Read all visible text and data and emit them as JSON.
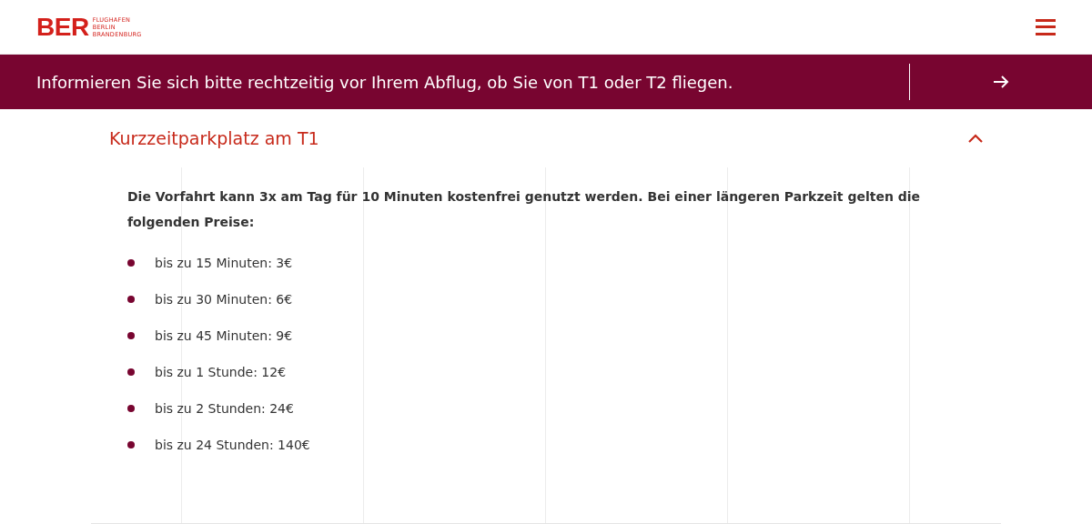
{
  "header": {
    "logo": {
      "mark": "BER",
      "lines": [
        "FLUGHAFEN",
        "BERLIN",
        "BRANDENBURG"
      ]
    }
  },
  "banner": {
    "text": "Informieren Sie sich bitte rechtzeitig vor Ihrem Abflug, ob Sie von T1 oder T2 fliegen."
  },
  "accordion": {
    "title": "Kurzzeitparkplatz am T1",
    "expanded": true,
    "intro": "Die Vorfahrt kann 3x am Tag für 10 Minuten kostenfrei genutzt werden. Bei einer längeren Parkzeit gelten die folgenden Preise:",
    "prices": [
      "bis zu 15 Minuten: 3€",
      "bis zu 30 Minuten: 6€",
      "bis zu 45 Minuten: 9€",
      "bis zu 1 Stunde: 12€",
      "bis zu 2 Stunden: 24€",
      "bis zu 24 Stunden: 140€"
    ]
  }
}
